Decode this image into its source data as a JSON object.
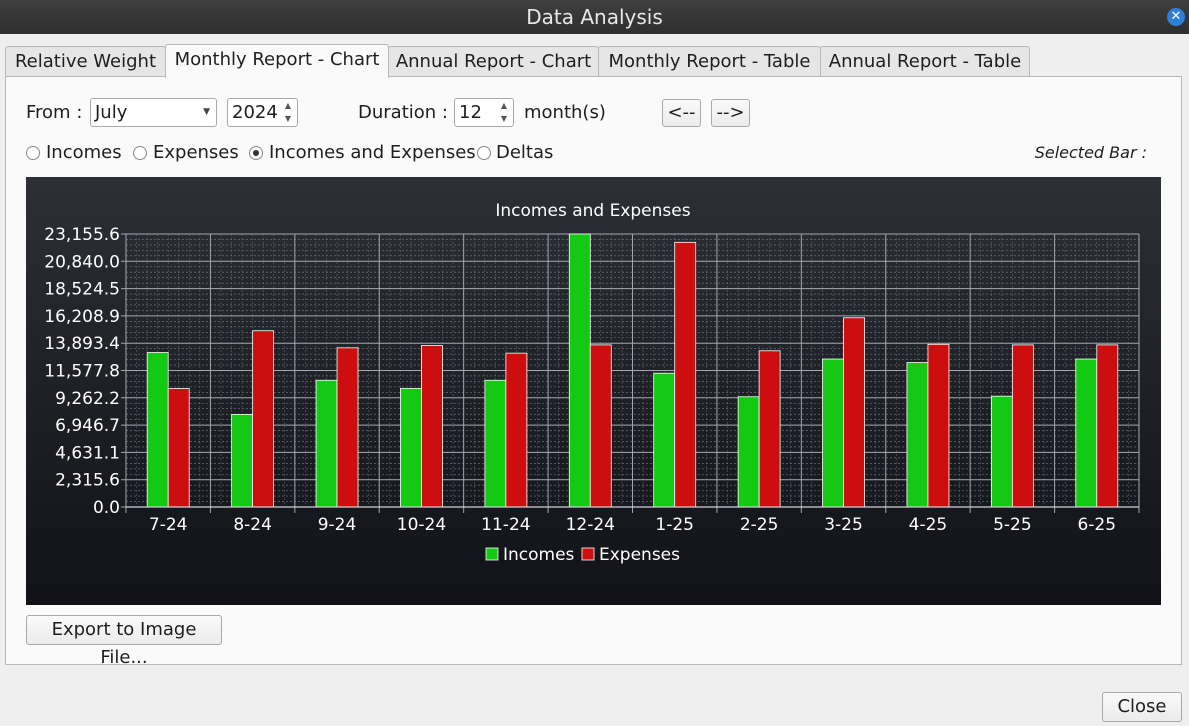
{
  "window": {
    "title": "Data Analysis"
  },
  "tabs": [
    {
      "label": "Relative Weight"
    },
    {
      "label": "Monthly Report - Chart"
    },
    {
      "label": "Annual Report - Chart"
    },
    {
      "label": "Monthly Report - Table"
    },
    {
      "label": "Annual Report - Table"
    }
  ],
  "controls": {
    "from_label": "From :",
    "month_value": "July",
    "year_value": "2024",
    "duration_label": "Duration :",
    "duration_value": "12",
    "duration_unit": "month(s)",
    "prev_label": "<--",
    "next_label": "-->",
    "selected_bar_label": "Selected Bar :"
  },
  "radios": [
    {
      "label": "Incomes",
      "checked": false
    },
    {
      "label": "Expenses",
      "checked": false
    },
    {
      "label": "Incomes and Expenses",
      "checked": true
    },
    {
      "label": "Deltas",
      "checked": false
    }
  ],
  "buttons": {
    "export_label": "Export to Image File...",
    "close_label": "Close"
  },
  "colors": {
    "income": "#13c913",
    "expense": "#cc0e0e",
    "chart_bg_top": "#2c2f36",
    "chart_bg_bottom": "#111217",
    "accent": "#2f7fd8"
  },
  "chart_data": {
    "type": "bar",
    "title": "Incomes and Expenses",
    "categories": [
      "7-24",
      "8-24",
      "9-24",
      "10-24",
      "11-24",
      "12-24",
      "1-25",
      "2-25",
      "3-25",
      "4-25",
      "5-25",
      "6-25"
    ],
    "series": [
      {
        "name": "Incomes",
        "values": [
          13100,
          7850,
          10750,
          10050,
          10750,
          23155.6,
          11350,
          9350,
          12550,
          12250,
          9400,
          12550
        ]
      },
      {
        "name": "Expenses",
        "values": [
          10050,
          14950,
          13500,
          13700,
          13050,
          13750,
          22450,
          13250,
          16050,
          13800,
          13750,
          13750
        ]
      }
    ],
    "ylim": [
      0,
      23155.6
    ],
    "yticks": [
      "0.0",
      "2,315.6",
      "4,631.1",
      "6,946.7",
      "9,262.2",
      "11,577.8",
      "13,893.4",
      "16,208.9",
      "18,524.5",
      "20,840.0",
      "23,155.6"
    ],
    "grid": true,
    "legend": "bottom-center"
  }
}
